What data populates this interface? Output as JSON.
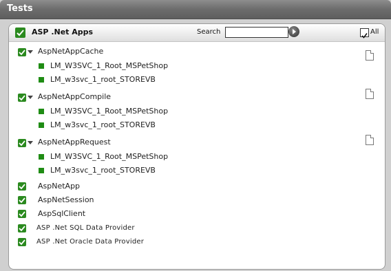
{
  "window": {
    "title": "Tests"
  },
  "header": {
    "group_label": "ASP .Net Apps",
    "search_label": "Search",
    "search_value": "",
    "all_label": "All",
    "all_checked": true
  },
  "tree": {
    "cache": {
      "label": "AspNetAppCache",
      "children": [
        "LM_W3SVC_1_Root_MSPetShop",
        "LM_w3svc_1_root_STOREVB"
      ]
    },
    "compile": {
      "label": "AspNetAppCompile",
      "children": [
        "LM_W3SVC_1_Root_MSPetShop",
        "LM_w3svc_1_root_STOREVB"
      ]
    },
    "request": {
      "label": "AspNetAppRequest",
      "children": [
        "LM_W3SVC_1_Root_MSPetShop",
        "LM_w3svc_1_root_STOREVB"
      ]
    }
  },
  "tests": [
    "AspNetApp",
    "AspNetSession",
    "AspSqlClient",
    "ASP .Net SQL Data Provider",
    "ASP .Net Oracle Data Provider"
  ],
  "colors": {
    "check_green": "#2b8a1f",
    "title_bar": "#6c6c6c"
  }
}
